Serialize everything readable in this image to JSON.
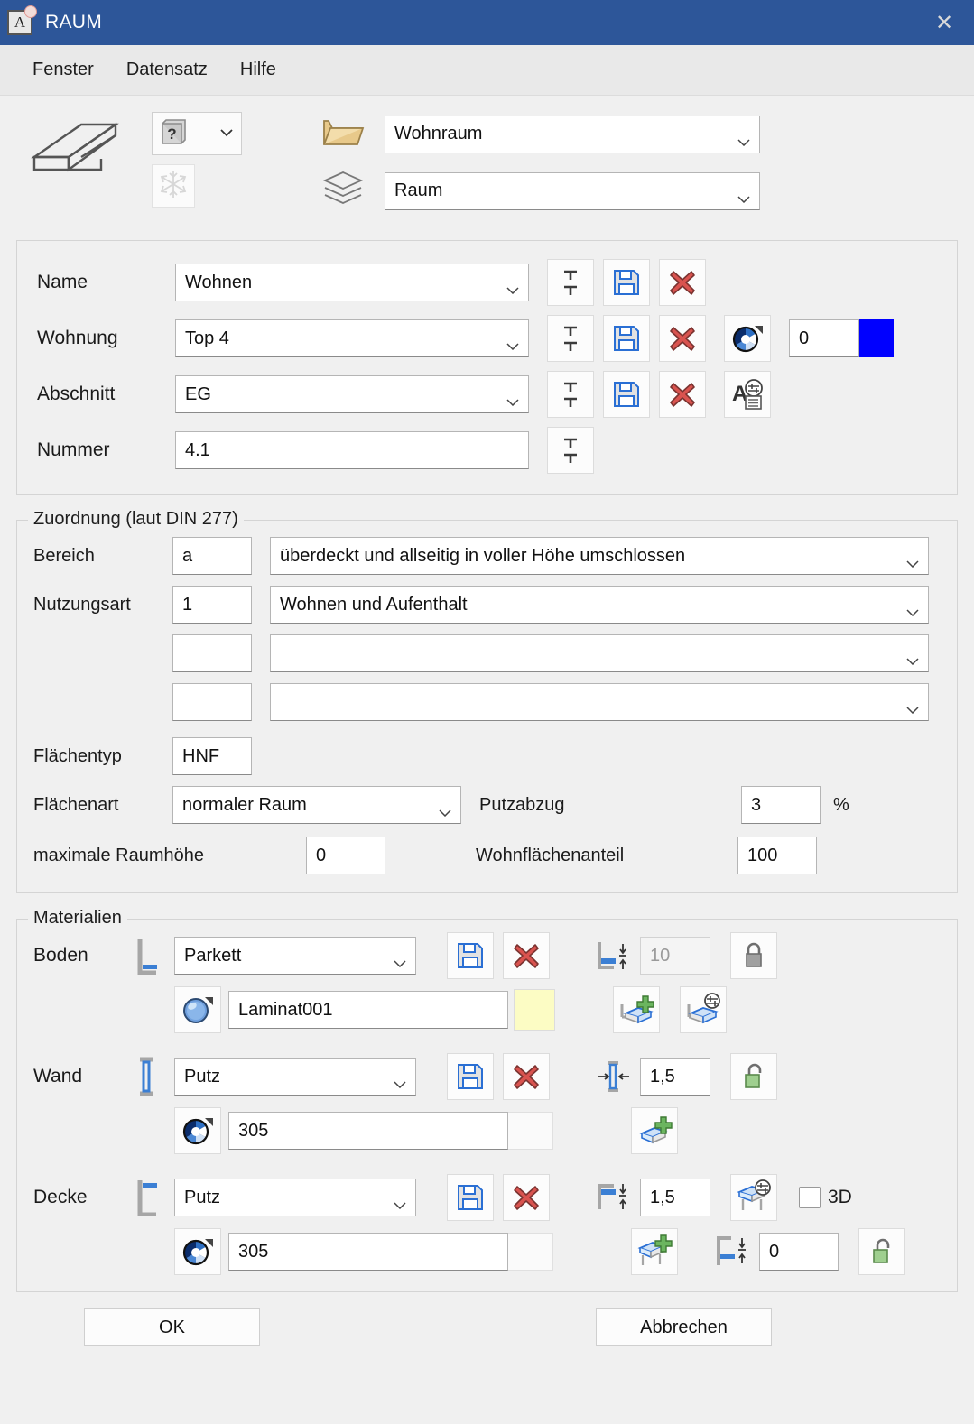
{
  "window": {
    "title": "RAUM",
    "app_icon": "A",
    "close_icon": "close-icon",
    "titlebar_color": "#2d5699"
  },
  "menu": {
    "items": [
      {
        "label": "Fenster"
      },
      {
        "label": "Datensatz"
      },
      {
        "label": "Hilfe"
      }
    ]
  },
  "toolbar": {
    "slab_icon": "slab-3d-icon",
    "help_book_icon": "book-question-icon",
    "help_dropdown_chevron": "chevron-down-icon",
    "freeze_icon": "snowflake-icon",
    "folder_icon": "open-folder-icon",
    "layers_icon": "layers-icon",
    "folder_select_value": "Wohnraum",
    "layer_select_value": "Raum"
  },
  "identification": {
    "rows": [
      {
        "label": "Name",
        "value": "Wohnen",
        "type": "select",
        "buttons": [
          "text-style-icon",
          "save-icon",
          "delete-icon"
        ]
      },
      {
        "label": "Wohnung",
        "value": "Top 4",
        "type": "select",
        "buttons": [
          "text-style-icon",
          "save-icon",
          "delete-icon",
          "color-wheel-icon"
        ],
        "pen_value": "0",
        "color_swatch": "#0000ff"
      },
      {
        "label": "Abschnitt",
        "value": "EG",
        "type": "select",
        "buttons": [
          "text-style-icon",
          "save-icon",
          "delete-icon",
          "text-attributes-icon"
        ]
      },
      {
        "label": "Nummer",
        "value": "4.1",
        "type": "text",
        "buttons": [
          "text-style-icon"
        ]
      }
    ]
  },
  "zuordnung": {
    "legend": "Zuordnung (laut DIN 277)",
    "rows": [
      {
        "label": "Bereich",
        "code": "a",
        "description": "überdeckt und allseitig in voller Höhe umschlossen"
      },
      {
        "label": "Nutzungsart",
        "code": "1",
        "description": "Wohnen und Aufenthalt"
      },
      {
        "label": "",
        "code": "",
        "description": ""
      },
      {
        "label": "",
        "code": "",
        "description": ""
      }
    ],
    "flaechentyp": {
      "label": "Flächentyp",
      "value": "HNF"
    },
    "flaechenart": {
      "label": "Flächenart",
      "value": "normaler Raum"
    },
    "putzabzug": {
      "label": "Putzabzug",
      "value": "3",
      "unit": "%"
    },
    "raumhoehe": {
      "label": "maximale Raumhöhe",
      "value": "0"
    },
    "wohnflaechenanteil": {
      "label": "Wohnflächenanteil",
      "value": "100"
    }
  },
  "materialien": {
    "legend": "Materialien",
    "boden": {
      "label": "Boden",
      "edge_icon": "floor-edge-icon",
      "material": "Parkett",
      "save_icon": "save-icon",
      "delete_icon": "delete-icon",
      "thickness_icon": "floor-thickness-icon",
      "thickness": "10",
      "lock_icon": "lock-closed-icon",
      "surface_icon": "sphere-material-icon",
      "surface": "Laminat001",
      "surface_swatch": "#fcfcc4",
      "add_layer_icon": "add-floor-layer-icon",
      "edit_layer_icon": "edit-floor-layer-icon"
    },
    "wand": {
      "label": "Wand",
      "edge_icon": "wall-edge-icon",
      "material": "Putz",
      "save_icon": "save-icon",
      "delete_icon": "delete-icon",
      "thickness_icon": "wall-thickness-icon",
      "thickness": "1,5",
      "lock_icon": "lock-open-icon",
      "surface_icon": "color-wheel-icon",
      "surface": "305",
      "add_layer_icon": "add-wall-layer-icon"
    },
    "decke": {
      "label": "Decke",
      "edge_icon": "ceiling-edge-icon",
      "material": "Putz",
      "save_icon": "save-icon",
      "delete_icon": "delete-icon",
      "thickness_icon": "ceiling-thickness-icon",
      "thickness": "1,5",
      "edit_layer_icon": "edit-ceiling-layer-icon",
      "checkbox_3d_label": "3D",
      "checkbox_3d_checked": false,
      "surface_icon": "color-wheel-icon",
      "surface": "305",
      "add_layer_icon": "add-ceiling-layer-icon",
      "offset_icon": "ceiling-offset-icon",
      "offset": "0",
      "lock_icon": "lock-open-icon"
    }
  },
  "footer": {
    "ok_label": "OK",
    "cancel_label": "Abbrechen"
  }
}
